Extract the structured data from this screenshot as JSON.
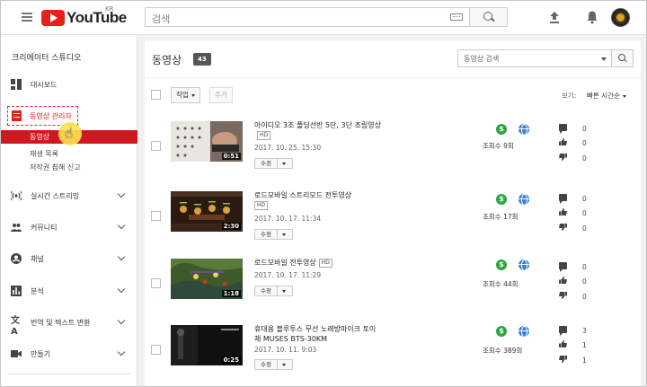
{
  "header": {
    "logo_text": "YouTube",
    "region": "KR",
    "search_placeholder": "검색"
  },
  "sidebar": {
    "studio_title": "크리에이터 스튜디오",
    "items": [
      {
        "label": "대시보드",
        "icon": "dashboard-icon"
      },
      {
        "label": "동영상 관리자",
        "icon": "video-manager-icon"
      },
      {
        "label": "실시간 스트리밍",
        "icon": "live-icon"
      },
      {
        "label": "커뮤니티",
        "icon": "community-icon"
      },
      {
        "label": "채널",
        "icon": "channel-icon"
      },
      {
        "label": "분석",
        "icon": "analytics-icon"
      },
      {
        "label": "번역 및 텍스트 변환",
        "icon": "translate-icon"
      },
      {
        "label": "만들기",
        "icon": "create-icon"
      }
    ],
    "sub_items": [
      "동영상",
      "재생 목록",
      "저작권 침해 신고"
    ]
  },
  "main": {
    "title": "동영상",
    "count": "43",
    "search_placeholder": "동영상 검색",
    "action_label": "작업",
    "add_label": "추가",
    "view_label": "보기:",
    "view_value": "빠른 시간순",
    "edit_label": "수정",
    "hd_label": "HD",
    "videos": [
      {
        "title": "아이디오 3조 폴딩선반 5단, 3단 조립영상",
        "hd": true,
        "date": "2017. 10. 25. 15:30",
        "duration": "0:51",
        "views": "조회수 9회",
        "comments": "0",
        "likes": "0",
        "dislikes": "0"
      },
      {
        "title": "로드모바일 스트리모드 전투영상",
        "hd": true,
        "date": "2017. 10. 17. 11:34",
        "duration": "2:30",
        "views": "조회수 17회",
        "comments": "0",
        "likes": "0",
        "dislikes": "0"
      },
      {
        "title": "로드모바일 전투영상",
        "hd": true,
        "date": "2017. 10. 17. 11:29",
        "duration": "1:18",
        "views": "조회수 44회",
        "comments": "0",
        "likes": "0",
        "dislikes": "0"
      },
      {
        "title": "휴대용 블루투스 무선 노래방마이크 토이체 MUSES BTS-30KM",
        "hd": false,
        "date": "2017. 10. 11. 9:03",
        "duration": "0:25",
        "views": "조회수 389회",
        "comments": "3",
        "likes": "1",
        "dislikes": "1"
      }
    ]
  }
}
